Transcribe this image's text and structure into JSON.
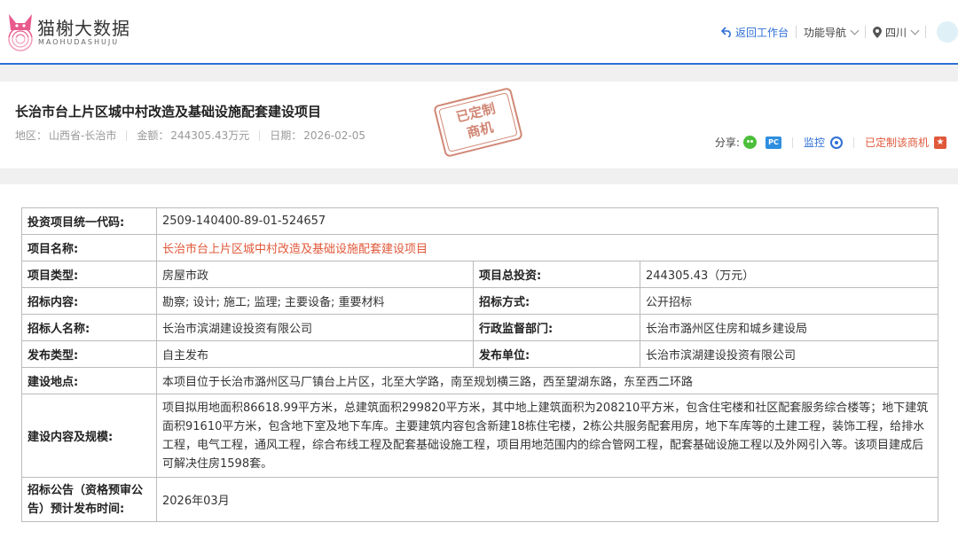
{
  "header": {
    "logo_name": "猫榭大数据",
    "logo_sub": "MAOHUDASHUJU",
    "nav": {
      "return_label": "返回工作台",
      "functions_label": "功能导航",
      "region_label": "四川"
    }
  },
  "project": {
    "title": "长治市台上片区城中村改造及基础设施配套建设项目",
    "meta": [
      {
        "label": "地区：",
        "value": "山西省-长治市"
      },
      {
        "label": "金额：",
        "value": "244305.43万元"
      },
      {
        "label": "日期：",
        "value": "2026-02-05"
      }
    ],
    "stamp_text": [
      "已定制",
      "商机"
    ],
    "actions": {
      "share_label": "分享:",
      "pc_icon_text": "PC",
      "monitor_label": "监控",
      "custom_label": "已定制该商机"
    }
  },
  "details": {
    "rows": [
      {
        "k": "投资项目统一代码:",
        "v": "2509-140400-89-01-524657"
      },
      {
        "k": "项目名称:",
        "v": "长治市台上片区城中村改造及基础设施配套建设项目"
      },
      {
        "k": "项目类型:",
        "v": "房屋市政",
        "k2": "项目总投资:",
        "v2": "244305.43（万元）"
      },
      {
        "k": "招标内容:",
        "v": "勘察; 设计; 施工; 监理; 主要设备; 重要材料",
        "k2": "招标方式:",
        "v2": "公开招标"
      },
      {
        "k": "招标人名称:",
        "v": "长治市滨湖建设投资有限公司",
        "k2": "行政监督部门:",
        "v2": "长治市潞州区住房和城乡建设局"
      },
      {
        "k": "发布类型:",
        "v": "自主发布",
        "k2": "发布单位:",
        "v2": "长治市滨湖建设投资有限公司"
      },
      {
        "k": "建设地点:",
        "v": "本项目位于长治市潞州区马厂镇台上片区，北至大学路，南至规划横三路，西至望湖东路，东至西二环路"
      },
      {
        "k": "建设内容及规模:",
        "v": "项目拟用地面积86618.99平方米，总建筑面积299820平方米，其中地上建筑面积为208210平方米，包含住宅楼和社区配套服务综合楼等；地下建筑面积91610平方米，包含地下室及地下车库。主要建筑内容包含新建18栋住宅楼，2栋公共服务配套用房，地下车库等的土建工程，装饰工程，给排水工程，电气工程，通风工程，综合布线工程及配套基础设施工程，项目用地范围内的综合管网工程，配套基础设施工程以及外网引入等。该项目建成后可解决住房1598套。"
      },
      {
        "k": "招标公告（资格预审公告）预计发布时间:",
        "v": "2026年03月"
      }
    ]
  }
}
